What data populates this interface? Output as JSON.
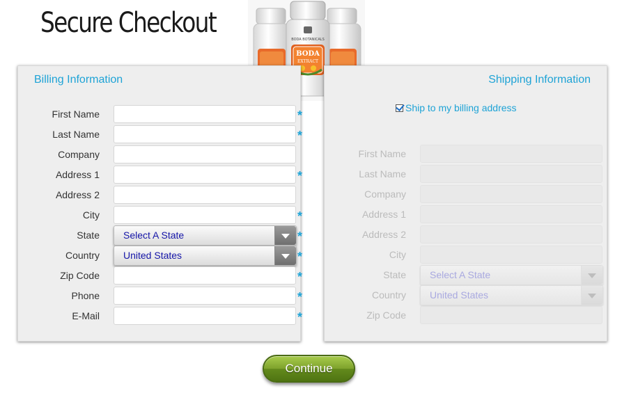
{
  "page": {
    "title": "Secure Checkout"
  },
  "product": {
    "brand": "BODA BOTANICALS",
    "name": "BODA",
    "subname": "EXTRACT"
  },
  "billing": {
    "title": "Billing Information",
    "fields": [
      {
        "label": "First Name",
        "required": true
      },
      {
        "label": "Last Name",
        "required": true
      },
      {
        "label": "Company",
        "required": false
      },
      {
        "label": "Address 1",
        "required": true
      },
      {
        "label": "Address 2",
        "required": false
      },
      {
        "label": "City",
        "required": true
      },
      {
        "label": "State",
        "required": true,
        "select": "Select A State"
      },
      {
        "label": "Country",
        "required": true,
        "select": "United States"
      },
      {
        "label": "Zip Code",
        "required": true
      },
      {
        "label": "Phone",
        "required": true
      },
      {
        "label": "E-Mail",
        "required": true
      }
    ]
  },
  "shipping": {
    "title": "Shipping Information",
    "same_as_billing_label": "Ship to my billing address",
    "same_as_billing": true,
    "fields": [
      {
        "label": "First Name"
      },
      {
        "label": "Last Name"
      },
      {
        "label": "Company"
      },
      {
        "label": "Address 1"
      },
      {
        "label": "Address 2"
      },
      {
        "label": "City"
      },
      {
        "label": "State",
        "select": "Select A State"
      },
      {
        "label": "Country",
        "select": "United States"
      },
      {
        "label": "Zip Code"
      }
    ]
  },
  "continue_label": "Continue",
  "colors": {
    "accent": "#1ea3d6",
    "button": "#7ea22c",
    "panel": "#eeeeee"
  },
  "required_marker": "*"
}
